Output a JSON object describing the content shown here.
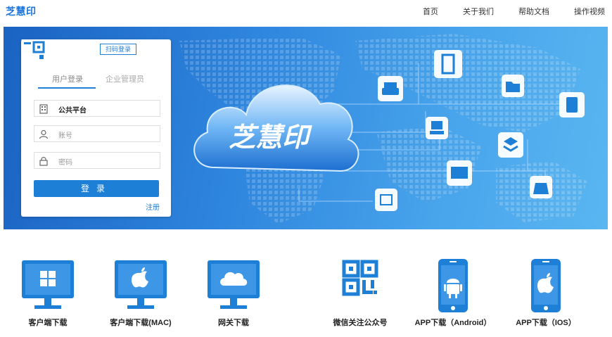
{
  "brand": {
    "logo_text": "芝慧印",
    "accent": "#1e7fd6"
  },
  "nav": {
    "items": [
      {
        "label": "首页"
      },
      {
        "label": "关于我们"
      },
      {
        "label": "帮助文档"
      },
      {
        "label": "操作视频"
      }
    ]
  },
  "banner": {
    "cloud_text": "芝慧印"
  },
  "login": {
    "qr_login_label": "扫码登录",
    "tabs": [
      {
        "label": "用户登录"
      },
      {
        "label": "企业管理员"
      }
    ],
    "platform_value": "公共平台",
    "account_placeholder": "账号",
    "password_placeholder": "密码",
    "login_button": "登录",
    "register_link": "注册"
  },
  "downloads": {
    "items": [
      {
        "label": "客户端下载",
        "icon": "windows-monitor-icon"
      },
      {
        "label": "客户端下载(MAC)",
        "icon": "apple-monitor-icon"
      },
      {
        "label": "网关下载",
        "icon": "cloud-monitor-icon"
      },
      {
        "label": "微信关注公众号",
        "icon": "qr-code-icon"
      },
      {
        "label": "APP下载（Android）",
        "icon": "android-phone-icon"
      },
      {
        "label": "APP下载（IOS）",
        "icon": "apple-phone-icon"
      }
    ]
  }
}
